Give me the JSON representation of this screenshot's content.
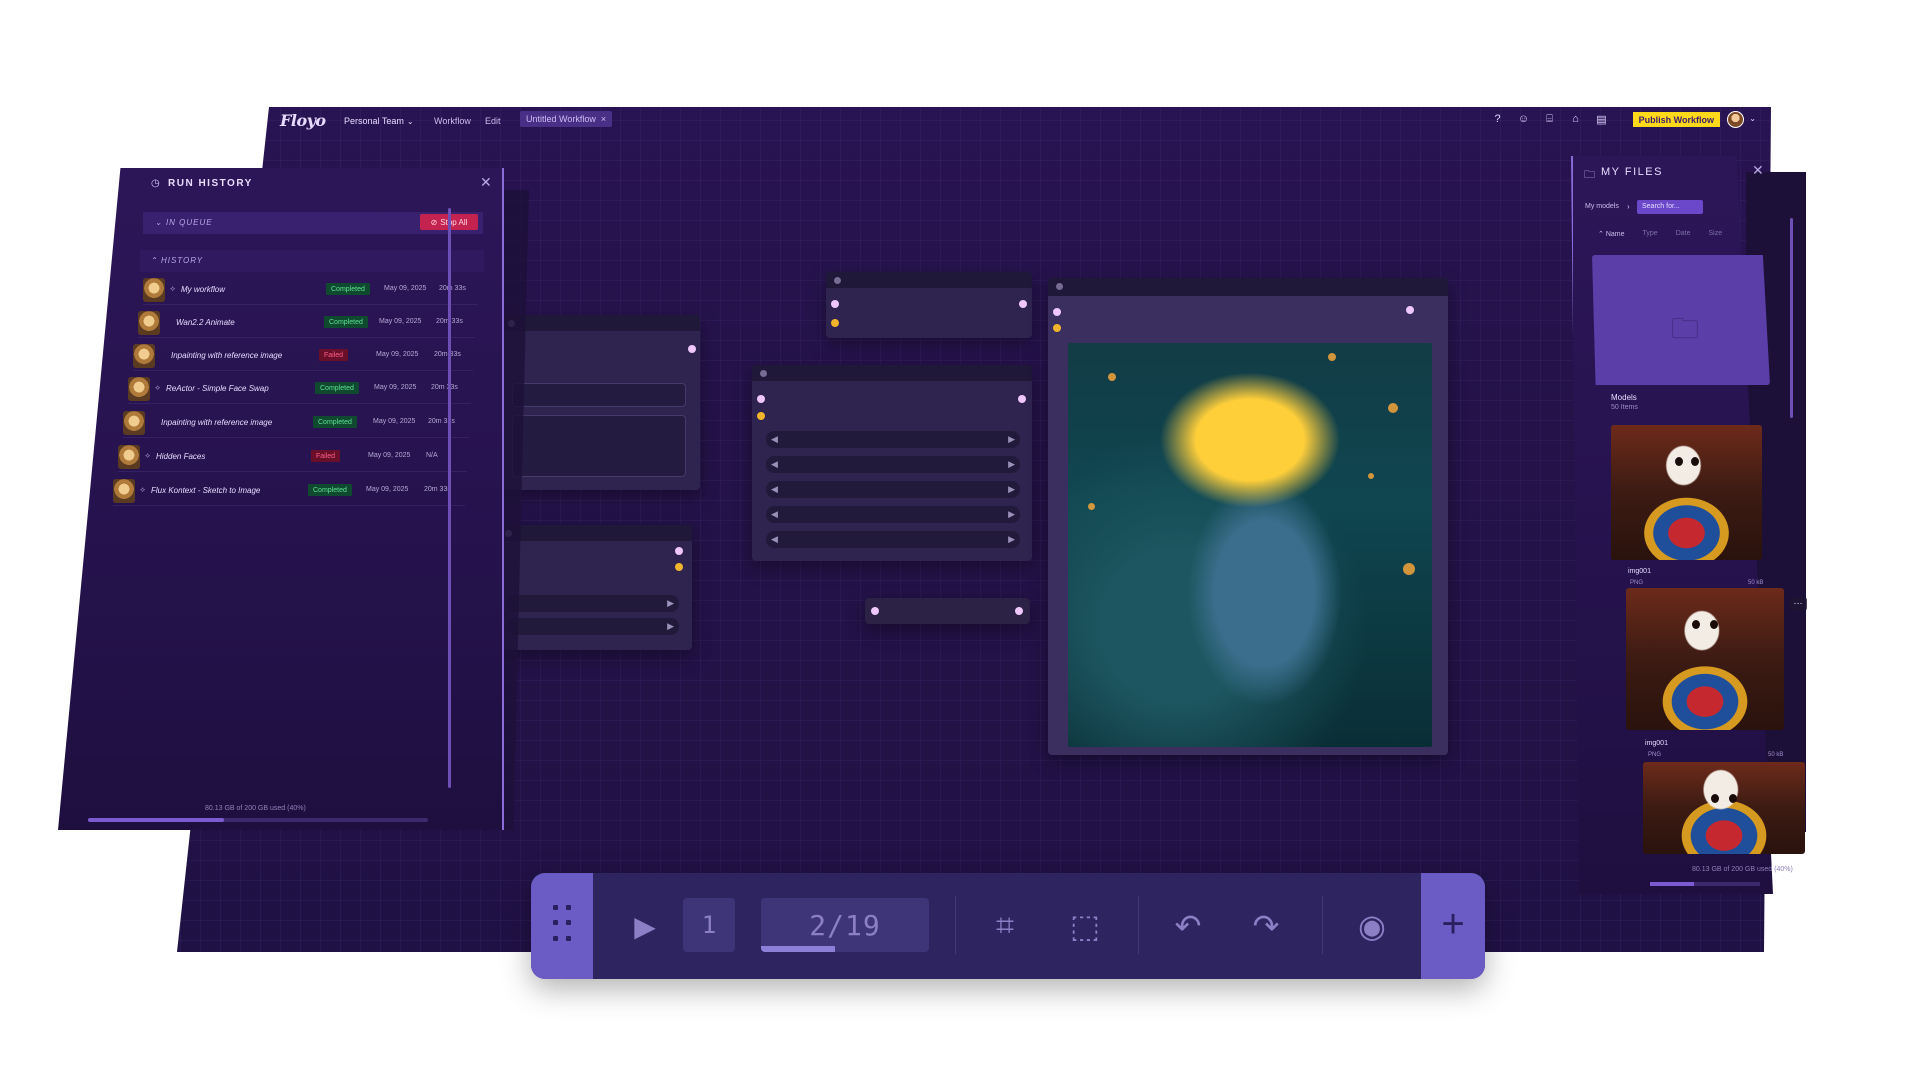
{
  "app": {
    "logo": "Floyo",
    "team": "Personal Team",
    "menu": {
      "workflow": "Workflow",
      "edit": "Edit"
    },
    "document_tab": "Untitled Workflow",
    "publish_label": "Publish Workflow",
    "top_icons": [
      "help-icon",
      "discord-icon",
      "gift-icon",
      "academy-icon",
      "docs-icon"
    ]
  },
  "run_history": {
    "title": "RUN HISTORY",
    "queue_label": "IN QUEUE",
    "stop_all_label": "Stop All",
    "history_label": "HISTORY",
    "rows": [
      {
        "name": "My workflow",
        "status": "Completed",
        "date": "May 09, 2025",
        "duration": "20m 33s"
      },
      {
        "name": "Wan2.2 Animate",
        "status": "Completed",
        "date": "May 09, 2025",
        "duration": "20m 33s"
      },
      {
        "name": "Inpainting with reference image",
        "status": "Failed",
        "date": "May 09, 2025",
        "duration": "20m 33s"
      },
      {
        "name": "ReActor - Simple Face Swap",
        "status": "Completed",
        "date": "May 09, 2025",
        "duration": "20m 33s"
      },
      {
        "name": "Inpainting with reference image",
        "status": "Completed",
        "date": "May 09, 2025",
        "duration": "20m 33s"
      },
      {
        "name": "Hidden Faces",
        "status": "Failed",
        "date": "May 09, 2025",
        "duration": "N/A"
      },
      {
        "name": "Flux Kontext - Sketch to Image",
        "status": "Completed",
        "date": "May 09, 2025",
        "duration": "20m 33s"
      }
    ],
    "storage_text": "80.13 GB of 200 GB used (40%)",
    "storage_fraction": 0.4
  },
  "my_files": {
    "title": "MY FILES",
    "breadcrumb": "My models",
    "search_placeholder": "Search for...",
    "columns": [
      "Name",
      "Type",
      "Date",
      "Size"
    ],
    "folder": {
      "name": "Models",
      "count": "50 Items"
    },
    "files": [
      {
        "name": "img001",
        "type": "PNG",
        "size": "50 kB"
      },
      {
        "name": "img001",
        "type": "PNG",
        "size": "50 kB"
      }
    ],
    "more_label": "···",
    "storage_text": "80.13 GB of 200 GB used (40%)",
    "storage_fraction": 0.4
  },
  "toolbar": {
    "run_count": "1",
    "page_indicator": "2/19",
    "page_progress": 0.44,
    "icons": [
      "drag-grip-icon",
      "play-icon",
      "arrange-nodes-icon",
      "add-selection-icon",
      "undo-icon",
      "redo-icon",
      "view-icon",
      "add-icon"
    ],
    "plus_label": "+"
  },
  "colors": {
    "background": "#241248",
    "accent": "#6b5bc4",
    "publish": "#ffd91a",
    "completed": "#5ee392",
    "failed": "#ff5e86"
  }
}
